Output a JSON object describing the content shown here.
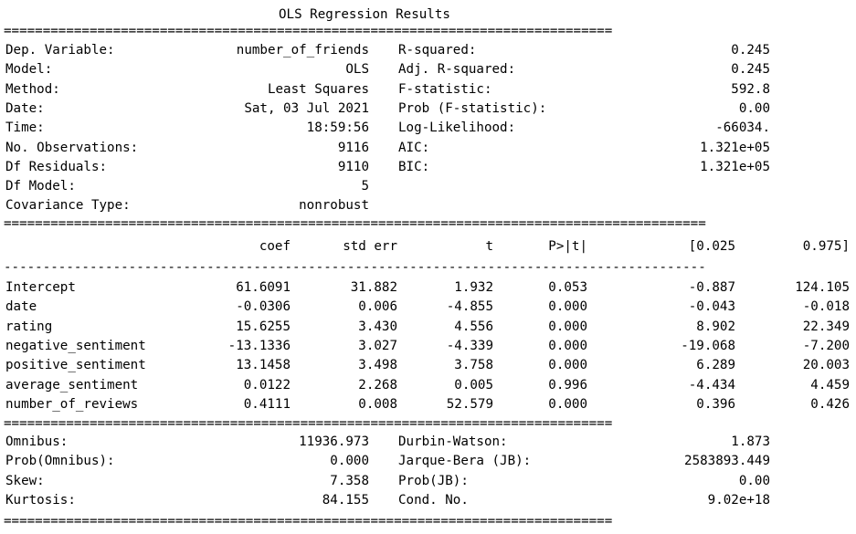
{
  "title": "OLS Regression Results",
  "separator": "==============================================================================",
  "separator_wide": "==========================================================================================",
  "dash_line": "------------------------------------------------------------------------------------------",
  "top": {
    "left_labels": [
      "Dep. Variable:",
      "Model:",
      "Method:",
      "Date:",
      "Time:",
      "No. Observations:",
      "Df Residuals:",
      "Df Model:",
      "Covariance Type:"
    ],
    "left_values": [
      "number_of_friends",
      "OLS",
      "Least Squares",
      "Sat, 03 Jul 2021",
      "18:59:56",
      "9116",
      "9110",
      "5",
      "nonrobust"
    ],
    "right_labels": [
      "R-squared:",
      "Adj. R-squared:",
      "F-statistic:",
      "Prob (F-statistic):",
      "Log-Likelihood:",
      "AIC:",
      "BIC:"
    ],
    "right_values": [
      "0.245",
      "0.245",
      "592.8",
      "0.00",
      "-66034.",
      "1.321e+05",
      "1.321e+05"
    ]
  },
  "coef_table": {
    "headers": [
      "coef",
      "std err",
      "t",
      "P>|t|",
      "[0.025",
      "0.975]"
    ],
    "rows": [
      {
        "name": "Intercept",
        "values": [
          "61.6091",
          "31.882",
          "1.932",
          "0.053",
          "-0.887",
          "124.105"
        ]
      },
      {
        "name": "date",
        "values": [
          "-0.0306",
          "0.006",
          "-4.855",
          "0.000",
          "-0.043",
          "-0.018"
        ]
      },
      {
        "name": "rating",
        "values": [
          "15.6255",
          "3.430",
          "4.556",
          "0.000",
          "8.902",
          "22.349"
        ]
      },
      {
        "name": "negative_sentiment",
        "values": [
          "-13.1336",
          "3.027",
          "-4.339",
          "0.000",
          "-19.068",
          "-7.200"
        ]
      },
      {
        "name": "positive_sentiment",
        "values": [
          "13.1458",
          "3.498",
          "3.758",
          "0.000",
          "6.289",
          "20.003"
        ]
      },
      {
        "name": "average_sentiment",
        "values": [
          "0.0122",
          "2.268",
          "0.005",
          "0.996",
          "-4.434",
          "4.459"
        ]
      },
      {
        "name": "number_of_reviews",
        "values": [
          "0.4111",
          "0.008",
          "52.579",
          "0.000",
          "0.396",
          "0.426"
        ]
      }
    ]
  },
  "bottom": {
    "left_labels": [
      "Omnibus:",
      "Prob(Omnibus):",
      "Skew:",
      "Kurtosis:"
    ],
    "left_values": [
      "11936.973",
      "0.000",
      "7.358",
      "84.155"
    ],
    "right_labels": [
      "Durbin-Watson:",
      "Jarque-Bera (JB):",
      "Prob(JB):",
      "Cond. No."
    ],
    "right_values": [
      "1.873",
      "2583893.449",
      "0.00",
      "9.02e+18"
    ]
  }
}
